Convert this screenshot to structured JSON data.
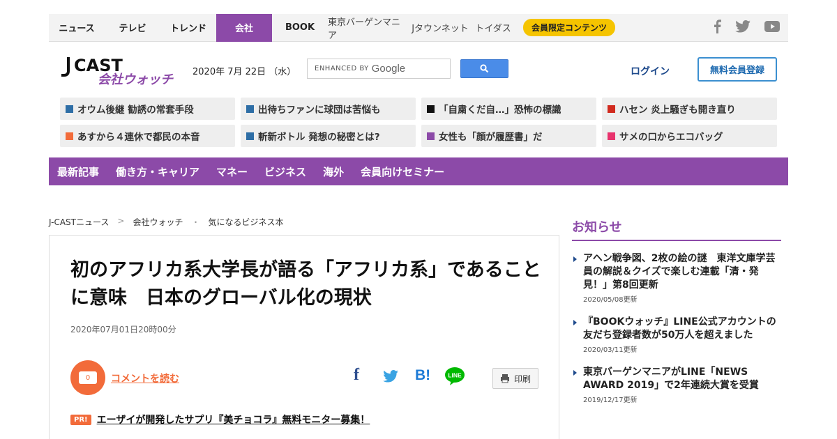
{
  "topnav": {
    "items": [
      "ニュース",
      "テレビ",
      "トレンド",
      "会社",
      "BOOK",
      "東京バーゲンマニア",
      "Jタウンネット",
      "トイダス"
    ],
    "active": "会社",
    "members_label": "会員限定コンテンツ",
    "social": [
      "facebook-icon",
      "twitter-icon",
      "youtube-icon"
    ]
  },
  "header": {
    "logo_main": "J-CAST",
    "logo_sub": "会社ウォッチ",
    "date": "2020年 7月 22日 （水）",
    "search_enhanced": "ENHANCED BY",
    "search_brand": "Google",
    "login": "ログイン",
    "register": "無料会員登録"
  },
  "picks": [
    {
      "label": "オウム後継 勧誘の常套手段",
      "color": "#2e6ea6"
    },
    {
      "label": "出待ちファンに球団は苦悩も",
      "color": "#2e6ea6"
    },
    {
      "label": "「自粛くだ自…」恐怖の標識",
      "color": "#111111"
    },
    {
      "label": "ハセン 炎上騒ぎも開き直り",
      "color": "#d12a1e"
    },
    {
      "label": "あすから４連休で都民の本音",
      "color": "#f26b3a"
    },
    {
      "label": "斬新ボトル 発想の秘密とは?",
      "color": "#2e6ea6"
    },
    {
      "label": "女性も「顔が履歴書」だ",
      "color": "#8c4aa8"
    },
    {
      "label": "サメの口からエコバッグ",
      "color": "#e8336d"
    }
  ],
  "categories": [
    "最新記事",
    "働き方・キャリア",
    "マネー",
    "ビジネス",
    "海外",
    "会員向けセミナー"
  ],
  "breadcrumb": [
    "J-CASTニュース",
    "会社ウォッチ",
    "気になるビジネス本"
  ],
  "article": {
    "title": "初のアフリカ系大学長が語る「アフリカ系」であることに意味　日本のグローバル化の現状",
    "date": "2020年07月01日20時00分",
    "comment_count": "0",
    "comment_link": "コメントを読む",
    "print": "印刷",
    "pr_badge": "PR!",
    "pr_text": "エーザイが開発したサプリ『美チョコラ』無料モニター募集！"
  },
  "sidebar": {
    "title": "お知らせ",
    "items": [
      {
        "title": "アヘン戦争図、2枚の絵の謎　東洋文庫学芸員の解説＆クイズで楽しむ連載「清・発見！」第8回更新",
        "date": "2020/05/08更新"
      },
      {
        "title": "『BOOKウォッチ』LINE公式アカウントの友だち登録者数が50万人を超えました",
        "date": "2020/03/11更新"
      },
      {
        "title": "東京バーゲンマニアがLINE「NEWS AWARD 2019」で2年連続大賞を受賞",
        "date": "2019/12/17更新"
      }
    ]
  },
  "colors": {
    "brand_purple": "#8c4aa8",
    "accent_orange": "#f26b3a",
    "member_yellow": "#f5c400"
  }
}
